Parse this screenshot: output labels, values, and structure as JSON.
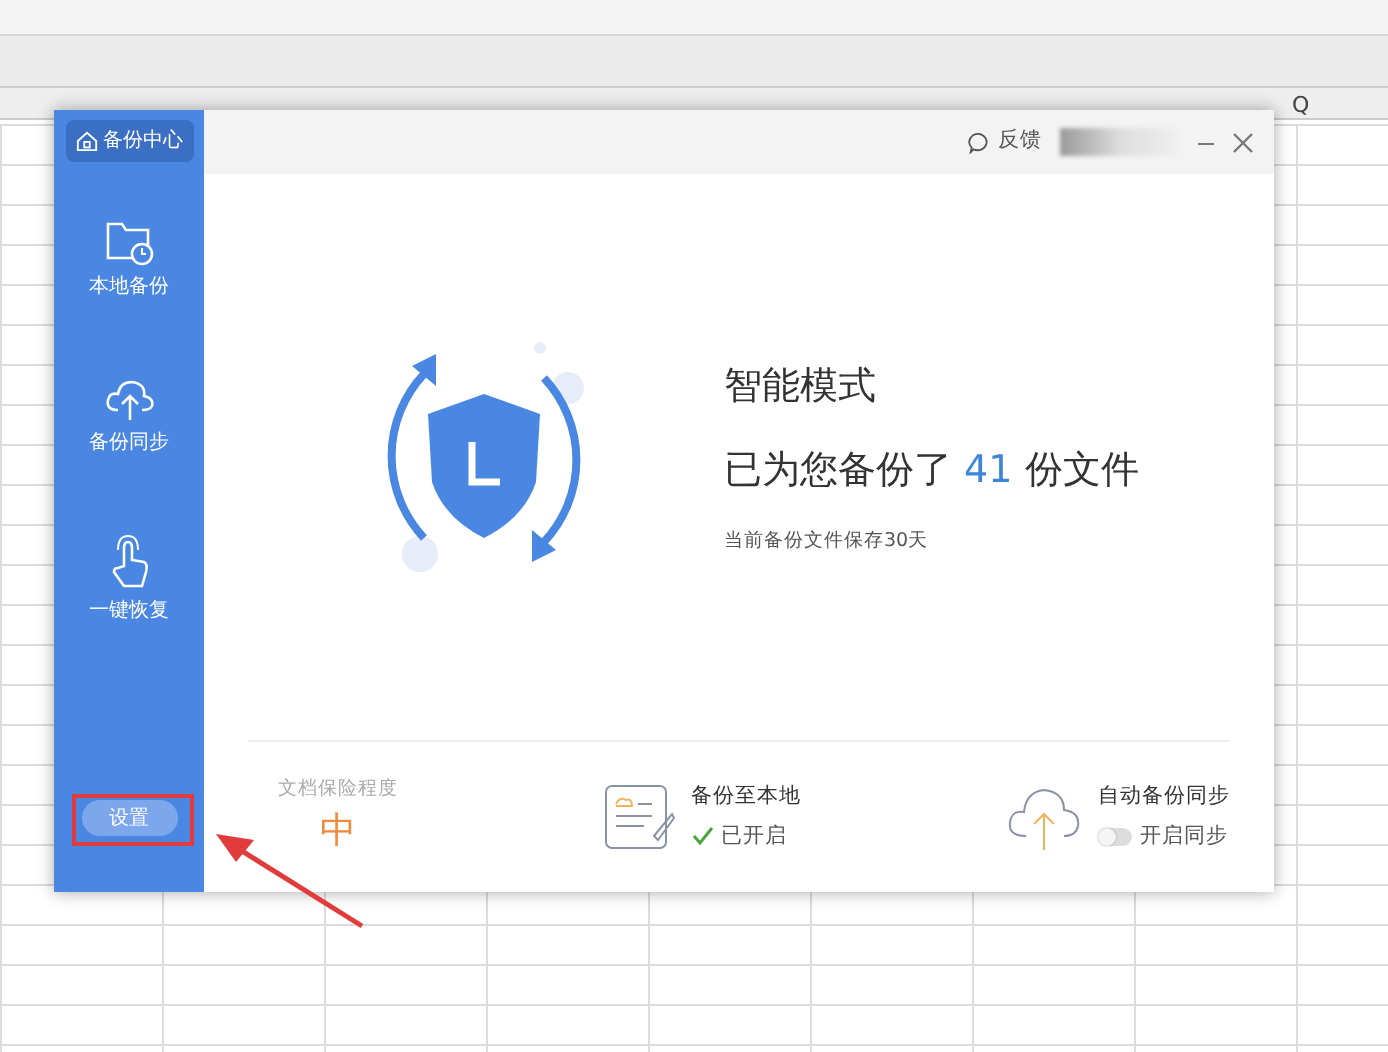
{
  "spreadsheet": {
    "column_headers": [
      "Q"
    ]
  },
  "dialog": {
    "brand": "备份中心",
    "feedback": "反馈",
    "nav": [
      {
        "label": "本地备份",
        "kind": "folder",
        "selected": false
      },
      {
        "label": "备份同步",
        "kind": "cloud",
        "selected": false
      },
      {
        "label": "一键恢复",
        "kind": "hand",
        "selected": false
      }
    ],
    "settings_button": "设置",
    "mode_title": "智能模式",
    "summary": {
      "prefix": "已为您备份了",
      "count": "41",
      "suffix": "份文件"
    },
    "retention_note": "当前备份文件保存30天",
    "protection": {
      "label": "文档保险程度",
      "value": "中"
    },
    "local_backup": {
      "title": "备份至本地",
      "status": "已开启",
      "on": true
    },
    "auto_sync": {
      "title": "自动备份同步",
      "status": "开启同步",
      "on": false
    }
  }
}
